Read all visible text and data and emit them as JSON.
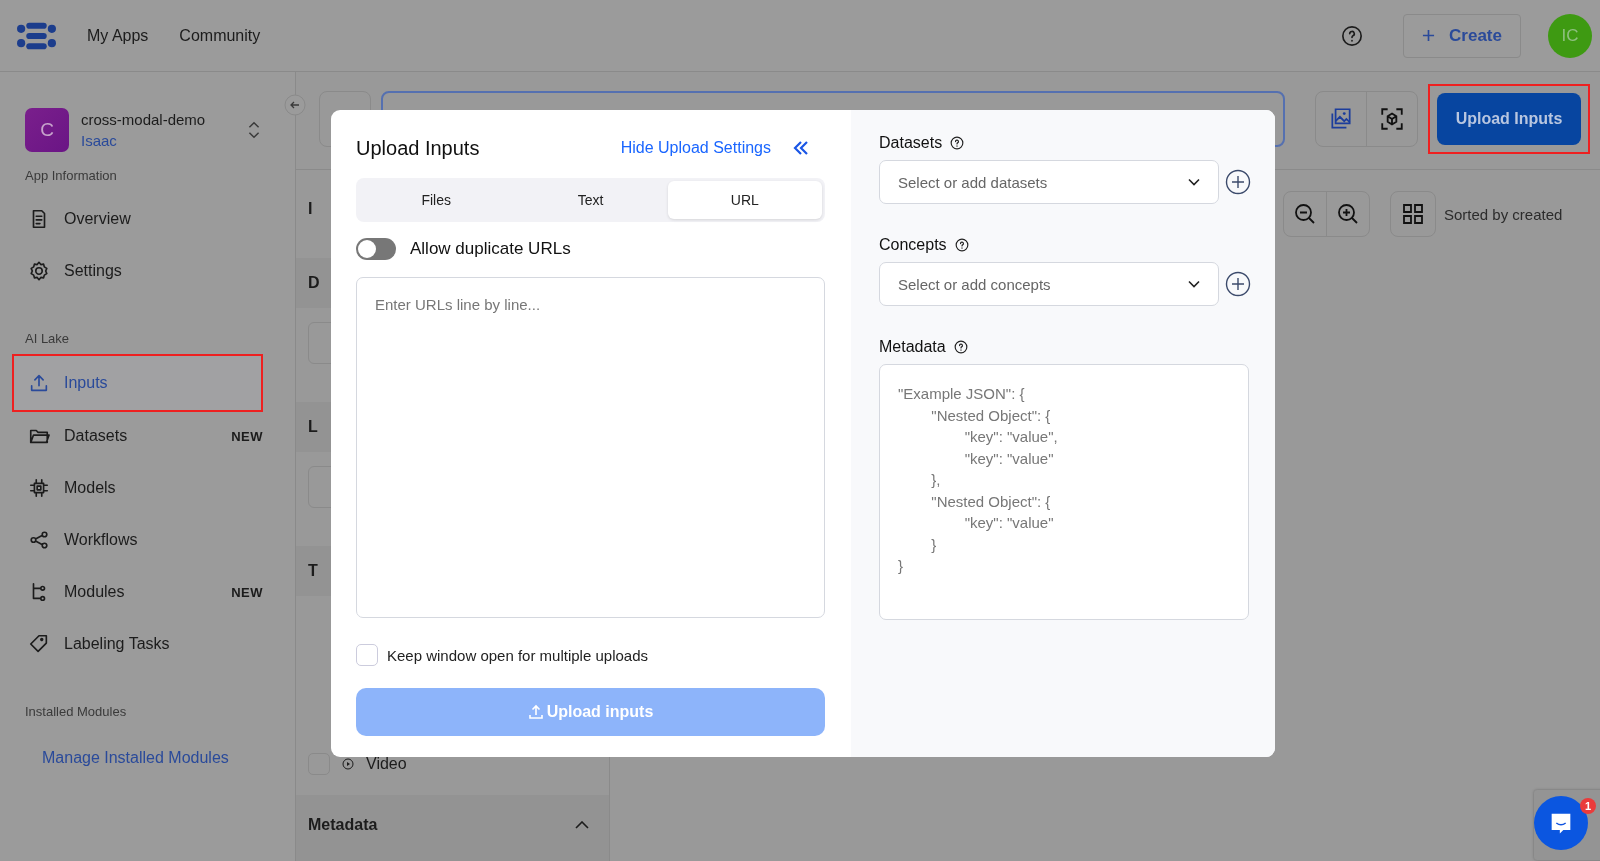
{
  "topbar": {
    "nav": [
      {
        "label": "My Apps"
      },
      {
        "label": "Community"
      }
    ],
    "create_button": {
      "label": "Create"
    },
    "avatar": "IC"
  },
  "sidebar": {
    "app": {
      "initial": "C",
      "name": "cross-modal-demo",
      "owner": "Isaac"
    },
    "sections": [
      {
        "title": "App Information",
        "items": [
          {
            "label": "Overview",
            "selected": false,
            "highlighted": false
          },
          {
            "label": "Settings",
            "selected": false,
            "highlighted": false
          }
        ]
      },
      {
        "title": "AI Lake",
        "items": [
          {
            "label": "Inputs",
            "selected": true,
            "highlighted": true
          },
          {
            "label": "Datasets",
            "badge": "NEW",
            "selected": false,
            "highlighted": false
          },
          {
            "label": "Models",
            "selected": false,
            "highlighted": false
          },
          {
            "label": "Workflows",
            "selected": false,
            "highlighted": false
          },
          {
            "label": "Modules",
            "badge": "NEW",
            "selected": false,
            "highlighted": false
          },
          {
            "label": "Labeling Tasks",
            "selected": false,
            "highlighted": false
          }
        ]
      },
      {
        "title": "Installed Modules",
        "links": [
          "Manage Installed Modules"
        ]
      }
    ]
  },
  "toolbar": {
    "upload_button": {
      "label": "Upload Inputs",
      "highlighted": true
    },
    "sort_label": "Sorted by created"
  },
  "filter_panel": {
    "headings": [
      "I",
      "D",
      "L",
      "T"
    ],
    "media_rows": [
      {
        "label": "Video",
        "checked": false
      }
    ],
    "metadata_header": "Metadata"
  },
  "modal": {
    "title": "Upload Inputs",
    "hide_link": "Hide Upload Settings",
    "tabs": [
      {
        "label": "Files",
        "selected": false
      },
      {
        "label": "Text",
        "selected": false
      },
      {
        "label": "URL",
        "selected": true
      }
    ],
    "toggle": {
      "label": "Allow duplicate URLs",
      "on": false
    },
    "url_field": {
      "placeholder": "Enter URLs line by line..."
    },
    "keep_open": {
      "label": "Keep window open for multiple uploads",
      "checked": false
    },
    "upload_button": {
      "label": "Upload inputs",
      "disabled": true
    },
    "datasets": {
      "label": "Datasets",
      "placeholder": "Select or add datasets"
    },
    "concepts": {
      "label": "Concepts",
      "placeholder": "Select or add concepts"
    },
    "metadata": {
      "label": "Metadata",
      "placeholder": "\"Example JSON\": {\n\t\"Nested Object\": {\n\t\t\"key\": \"value\",\n\t\t\"key\": \"value\"\n\t},\n\t\"Nested Object\": {\n\t\t\"key\": \"value\"\n\t}\n}"
    }
  },
  "chat": {
    "badge": "1"
  }
}
